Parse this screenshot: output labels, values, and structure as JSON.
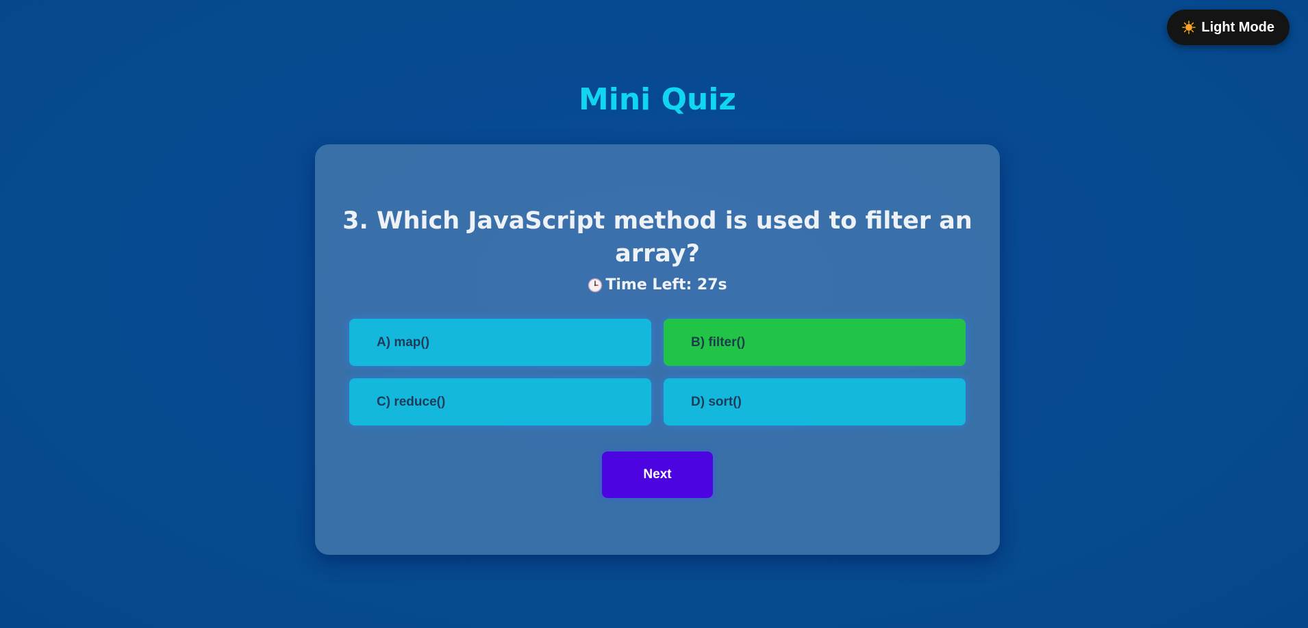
{
  "theme_toggle": {
    "icon": "sun-icon",
    "label": "Light Mode"
  },
  "header": {
    "title": "Mini Quiz"
  },
  "quiz": {
    "question": "3. Which JavaScript method is used to filter an array?",
    "timer": {
      "icon": "clock-icon",
      "label": "Time Left: 27s"
    },
    "options": [
      {
        "label": "A) map()",
        "state": "default"
      },
      {
        "label": "B) filter()",
        "state": "correct"
      },
      {
        "label": "C) reduce()",
        "state": "default"
      },
      {
        "label": "D) sort()",
        "state": "default"
      }
    ],
    "next_label": "Next"
  },
  "colors": {
    "background": "#074a93",
    "title": "#10d6f2",
    "option_default": "#14b8dc",
    "option_correct": "#22c447",
    "next_button": "#4c05e0",
    "toggle_bg": "#141414"
  }
}
